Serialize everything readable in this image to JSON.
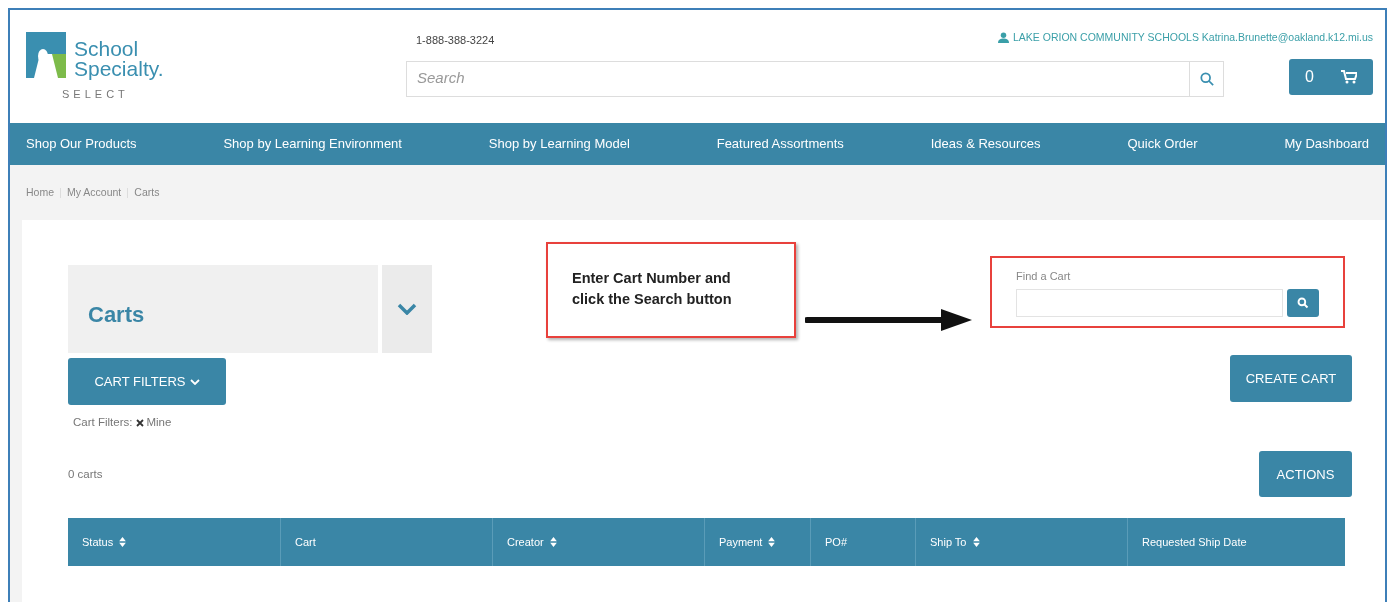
{
  "header": {
    "logo_text": "School",
    "logo_text_2": "Specialty.",
    "logo_sub": "SELECT",
    "phone": "1-888-388-3224",
    "search": {
      "placeholder": "Search"
    },
    "account": "LAKE ORION COMMUNITY SCHOOLS Katrina.Brunette@oakland.k12.mi.us",
    "cart_count": "0"
  },
  "nav": [
    "Shop Our Products",
    "Shop by Learning Environment",
    "Shop by Learning Model",
    "Featured Assortments",
    "Ideas & Resources",
    "Quick Order",
    "My Dashboard"
  ],
  "breadcrumb": [
    "Home",
    "My Account",
    "Carts"
  ],
  "page_title": "Carts",
  "find_cart": {
    "label": "Find a Cart"
  },
  "buttons": {
    "cart_filters": "CART FILTERS",
    "create_cart": "CREATE CART",
    "actions": "ACTIONS"
  },
  "filters_label": "Cart Filters:",
  "filters": [
    {
      "label": "Mine"
    }
  ],
  "count": "0 carts",
  "table": {
    "columns": [
      {
        "label": "Status",
        "sortable": true
      },
      {
        "label": "Cart",
        "sortable": false
      },
      {
        "label": "Creator",
        "sortable": true
      },
      {
        "label": "Payment",
        "sortable": true
      },
      {
        "label": "PO#",
        "sortable": false
      },
      {
        "label": "Ship To",
        "sortable": true
      },
      {
        "label": "Requested Ship Date",
        "sortable": false
      }
    ]
  },
  "annotation": {
    "text": "Enter Cart Number and click the Search button"
  }
}
